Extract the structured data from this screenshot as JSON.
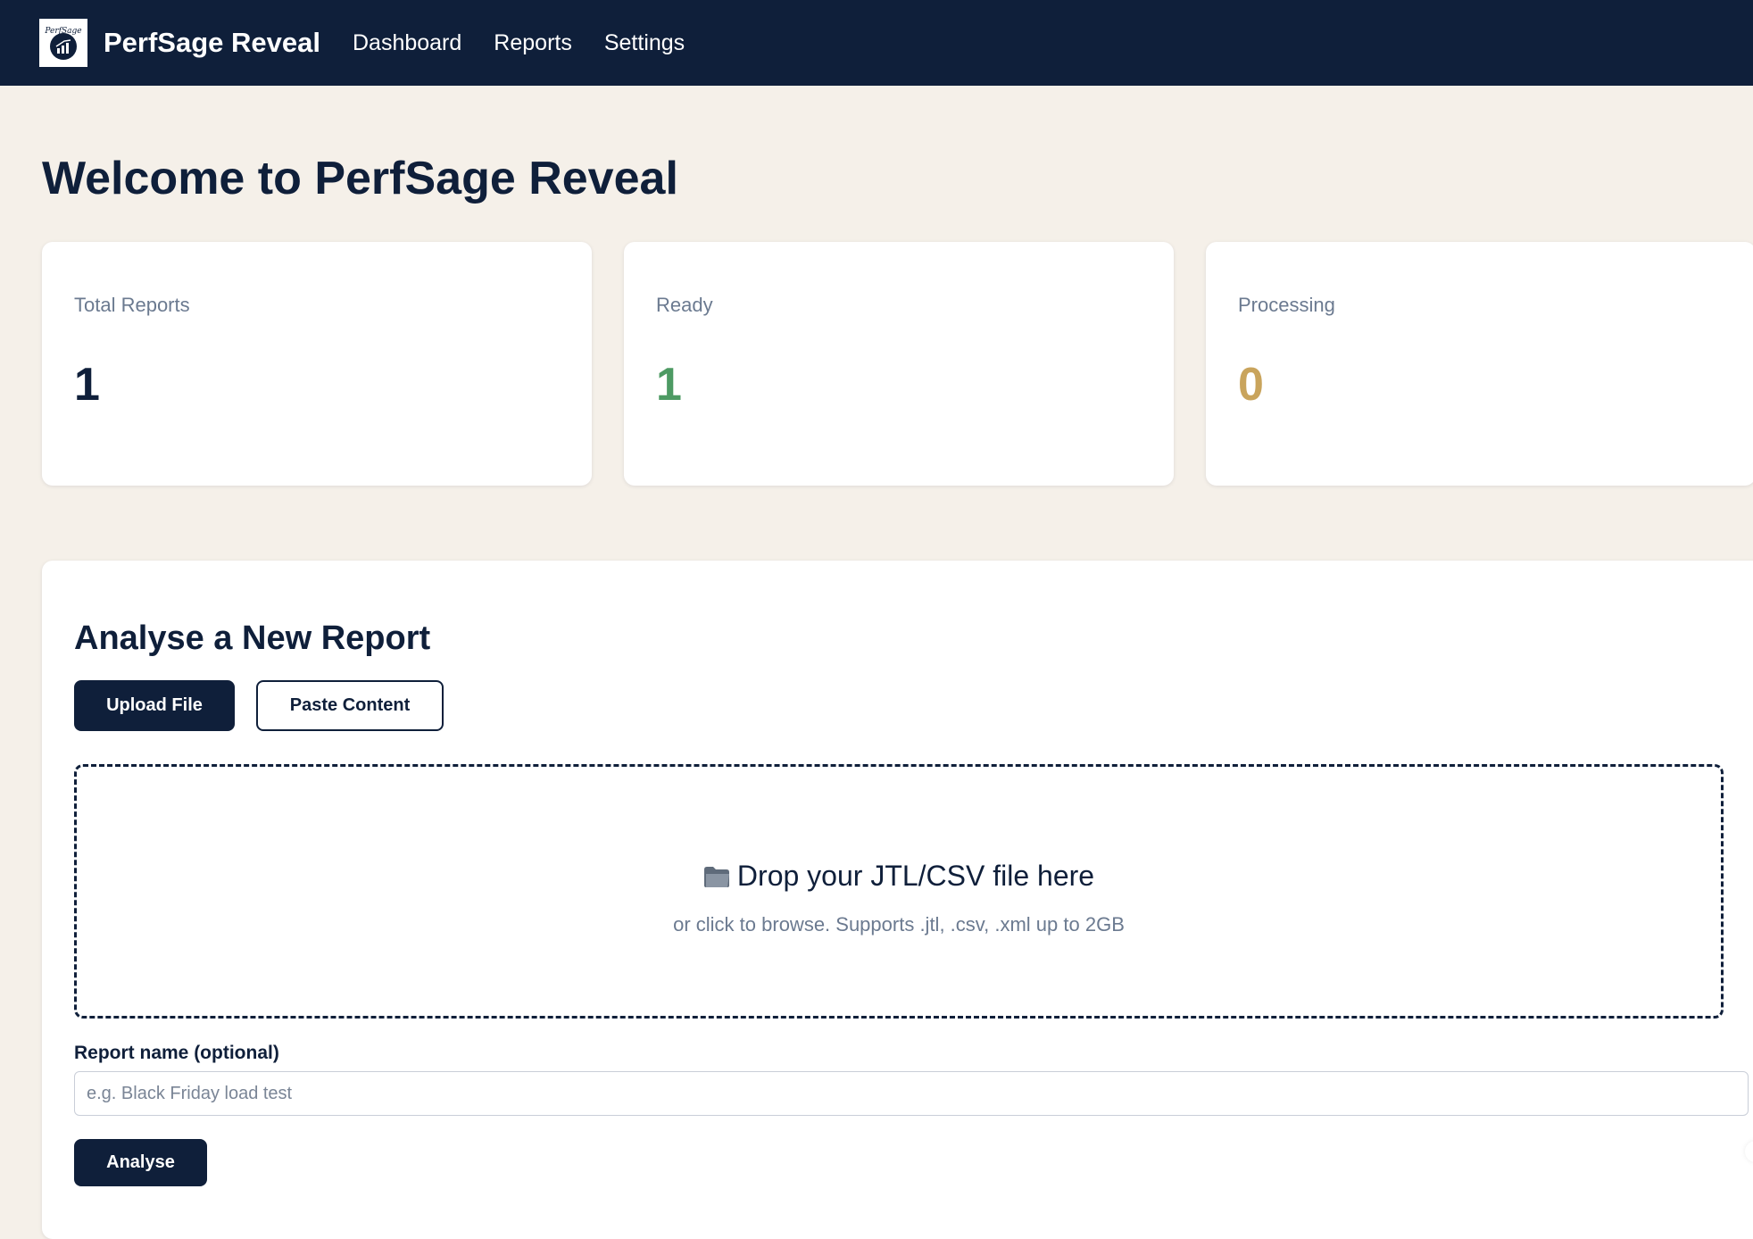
{
  "nav": {
    "logo_text": "PerfSage",
    "brand": "PerfSage Reveal",
    "links": [
      "Dashboard",
      "Reports",
      "Settings"
    ]
  },
  "page": {
    "title": "Welcome to PerfSage Reveal"
  },
  "stats": [
    {
      "label": "Total Reports",
      "value": "1",
      "color": "#0f1f3a"
    },
    {
      "label": "Ready",
      "value": "1",
      "color": "#4d9a63"
    },
    {
      "label": "Processing",
      "value": "0",
      "color": "#c9a45c"
    }
  ],
  "analyse": {
    "title": "Analyse a New Report",
    "upload_tab": "Upload File",
    "paste_tab": "Paste Content",
    "drop_title": "Drop your JTL/CSV file here",
    "drop_icon": "folder-icon",
    "drop_subtitle": "or click to browse. Supports .jtl, .csv, .xml up to 2GB",
    "name_label": "Report name (optional)",
    "name_placeholder": "e.g. Black Friday load test",
    "name_value": "",
    "submit": "Analyse"
  },
  "colors": {
    "navy": "#0f1f3a",
    "background": "#f5f0e9",
    "ready_green": "#4d9a63",
    "processing_gold": "#c9a45c",
    "muted_text": "#6b7a90"
  }
}
